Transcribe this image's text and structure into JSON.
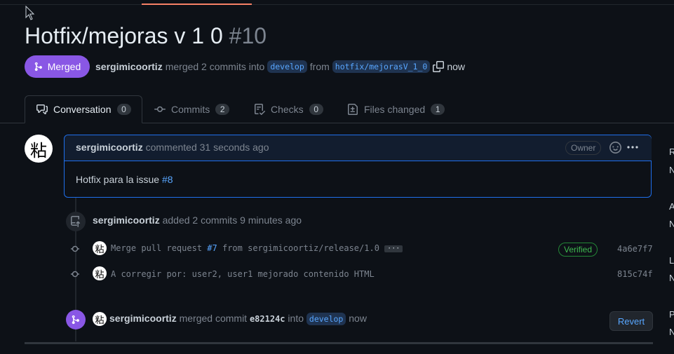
{
  "pr": {
    "title": "Hotfix/mejoras v 1 0",
    "number": "#10",
    "state_label": "Merged",
    "author": "sergimicoortiz",
    "meta_text": "merged 2 commits into",
    "base_branch": "develop",
    "from_text": "from",
    "head_branch": "hotfix/mejorasV_1_0",
    "time": "now"
  },
  "tabs": [
    {
      "label": "Conversation",
      "count": "0"
    },
    {
      "label": "Commits",
      "count": "2"
    },
    {
      "label": "Checks",
      "count": "0"
    },
    {
      "label": "Files changed",
      "count": "1"
    }
  ],
  "comment": {
    "avatar_glyph": "粘",
    "author": "sergimicoortiz",
    "action": "commented 31 seconds ago",
    "role": "Owner",
    "body_text": "Hotfix para la issue",
    "body_link": "#8"
  },
  "commits_event": {
    "author": "sergimicoortiz",
    "text": "added 2 commits 9 minutes ago"
  },
  "commits": [
    {
      "msg_before": "Merge pull request",
      "link": "#7",
      "msg_after": "from sergimicoortiz/release/1.0",
      "more": "···",
      "verified": "Verified",
      "sha": "4a6e7f7"
    },
    {
      "msg_before": "A corregir por: user2, user1 mejorado contenido HTML",
      "sha": "815c74f"
    }
  ],
  "merge_event": {
    "author": "sergimicoortiz",
    "text": "merged commit",
    "sha": "e82124c",
    "into": "into",
    "branch": "develop",
    "time": "now",
    "revert_label": "Revert"
  },
  "sidebar_letters": [
    "R",
    "N",
    "A",
    "N",
    "L",
    "N",
    "P",
    "N"
  ],
  "colors": {
    "accent_merged": "#8957e5",
    "link": "#58a6ff",
    "verified": "#3fb950",
    "tab_accent": "#f78166"
  }
}
